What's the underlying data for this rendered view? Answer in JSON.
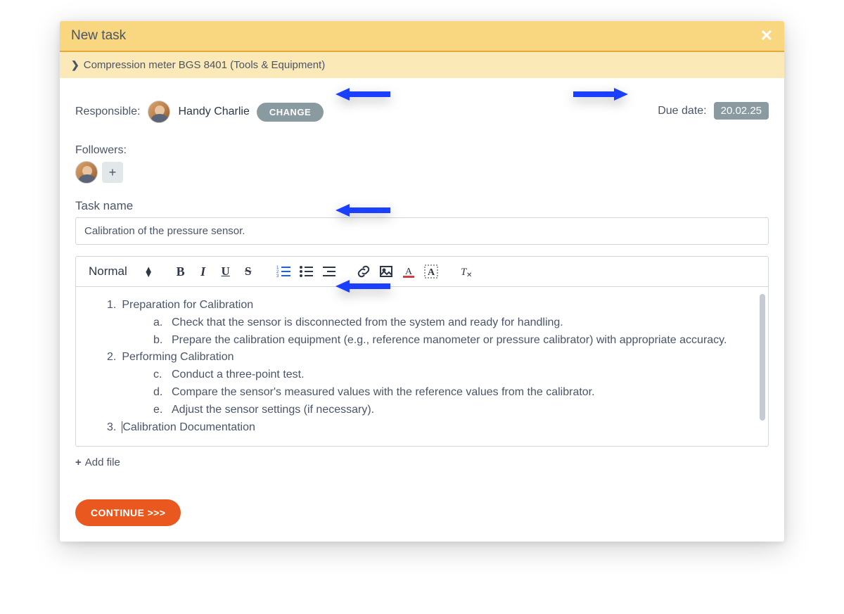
{
  "modal": {
    "title": "New task",
    "breadcrumb": "Compression meter BGS 8401 (Tools & Equipment)"
  },
  "responsible": {
    "label": "Responsible:",
    "name": "Handy Charlie",
    "change_label": "CHANGE"
  },
  "due": {
    "label": "Due date:",
    "value": "20.02.25"
  },
  "followers": {
    "label": "Followers:"
  },
  "task_name": {
    "label": "Task name",
    "value": "Calibration of the pressure sensor."
  },
  "toolbar": {
    "style_label": "Normal"
  },
  "editor": {
    "items": [
      {
        "num": "1.",
        "title": "Preparation for Calibration",
        "sub": [
          {
            "m": "a.",
            "t": "Check that the sensor is disconnected from the system and ready for handling."
          },
          {
            "m": "b.",
            "t": "Prepare the calibration equipment (e.g., reference manometer or pressure calibrator) with appropriate accuracy."
          }
        ]
      },
      {
        "num": "2.",
        "title": "Performing Calibration",
        "sub": [
          {
            "m": "c.",
            "t": "Conduct a three-point test."
          },
          {
            "m": "d.",
            "t": "Compare the sensor's measured values with the reference values from the calibrator."
          },
          {
            "m": "e.",
            "t": "Adjust the sensor settings (if necessary)."
          }
        ]
      },
      {
        "num": "3.",
        "title": "Calibration Documentation",
        "sub": []
      }
    ]
  },
  "add_file_label": "Add file",
  "continue_label": "CONTINUE >>>"
}
